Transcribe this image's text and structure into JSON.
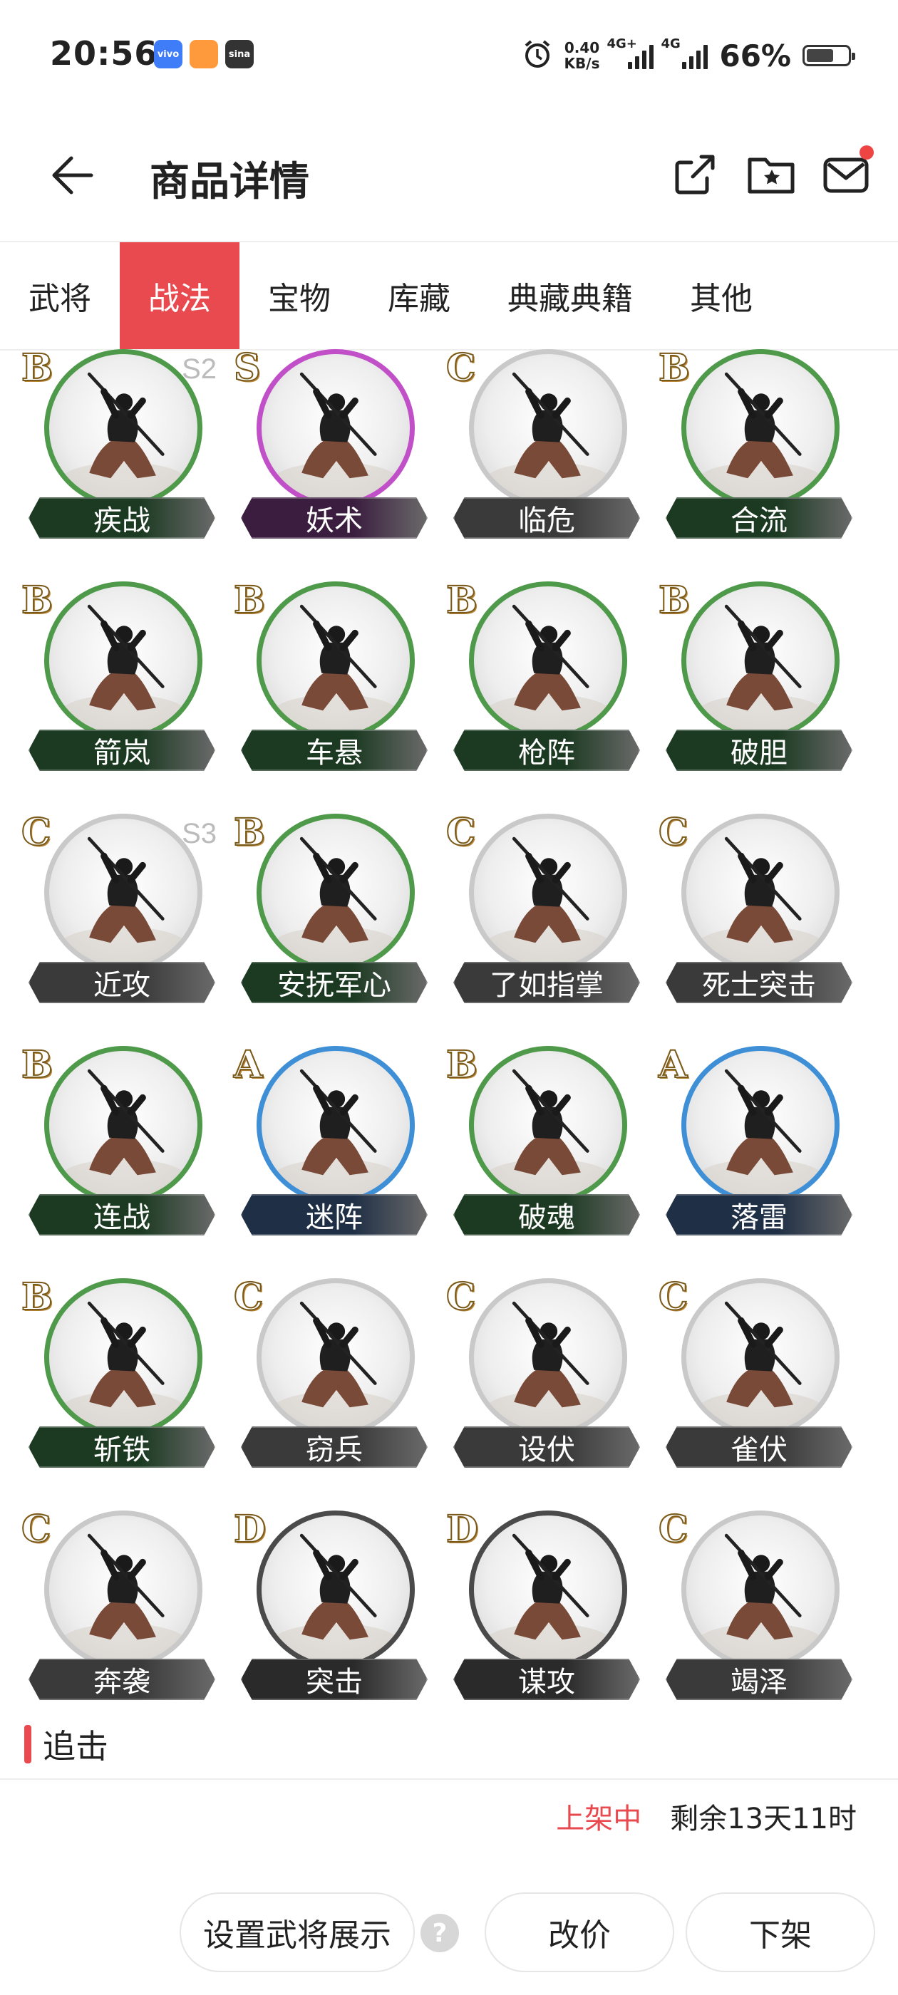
{
  "status_bar": {
    "time": "20:56",
    "net_speed_value": "0.40",
    "net_speed_unit": "KB/s",
    "sim1_label": "4G+",
    "sim2_label": "4G",
    "battery_percent": "66%",
    "battery_level": 0.66,
    "app_icons": [
      {
        "name": "vivo-icon",
        "label": "vivo",
        "color": "#3f7cf7"
      },
      {
        "name": "game-app-icon",
        "label": "",
        "color": "#ff9a3c"
      },
      {
        "name": "sina-icon",
        "label": "sina",
        "color": "#333333"
      }
    ]
  },
  "header": {
    "title": "商品详情",
    "icons": [
      "back-arrow-icon",
      "share-icon",
      "favorite-folder-icon",
      "mail-icon"
    ]
  },
  "tabs": [
    {
      "label": "武将",
      "active": false
    },
    {
      "label": "战法",
      "active": true
    },
    {
      "label": "宝物",
      "active": false
    },
    {
      "label": "库藏",
      "active": false
    },
    {
      "label": "典藏典籍",
      "active": false
    },
    {
      "label": "其他",
      "active": false
    }
  ],
  "skills": [
    {
      "name": "疾战",
      "rank": "B",
      "season": "S2"
    },
    {
      "name": "妖术",
      "rank": "S",
      "season": ""
    },
    {
      "name": "临危",
      "rank": "C",
      "season": ""
    },
    {
      "name": "合流",
      "rank": "B",
      "season": ""
    },
    {
      "name": "箭岚",
      "rank": "B",
      "season": ""
    },
    {
      "name": "车悬",
      "rank": "B",
      "season": ""
    },
    {
      "name": "枪阵",
      "rank": "B",
      "season": ""
    },
    {
      "name": "破胆",
      "rank": "B",
      "season": ""
    },
    {
      "name": "近攻",
      "rank": "C",
      "season": "S3"
    },
    {
      "name": "安抚军心",
      "rank": "B",
      "season": ""
    },
    {
      "name": "了如指掌",
      "rank": "C",
      "season": ""
    },
    {
      "name": "死士突击",
      "rank": "C",
      "season": ""
    },
    {
      "name": "连战",
      "rank": "B",
      "season": ""
    },
    {
      "name": "迷阵",
      "rank": "A",
      "season": ""
    },
    {
      "name": "破魂",
      "rank": "B",
      "season": ""
    },
    {
      "name": "落雷",
      "rank": "A",
      "season": ""
    },
    {
      "name": "斩铁",
      "rank": "B",
      "season": ""
    },
    {
      "name": "窃兵",
      "rank": "C",
      "season": ""
    },
    {
      "name": "设伏",
      "rank": "C",
      "season": ""
    },
    {
      "name": "雀伏",
      "rank": "C",
      "season": ""
    },
    {
      "name": "奔袭",
      "rank": "C",
      "season": ""
    },
    {
      "name": "突击",
      "rank": "D",
      "season": ""
    },
    {
      "name": "谋攻",
      "rank": "D",
      "season": ""
    },
    {
      "name": "竭泽",
      "rank": "C",
      "season": ""
    }
  ],
  "rank_colors": {
    "S": {
      "ring": "#c04fc8",
      "bar": "#3a1d3f"
    },
    "A": {
      "ring": "#3f8fd6",
      "bar": "#1f2f45"
    },
    "B": {
      "ring": "#4f9a4a",
      "bar": "#1c3a22"
    },
    "C": {
      "ring": "#c9c9c9",
      "bar": "#3a3a3a"
    },
    "D": {
      "ring": "#4a4a4a",
      "bar": "#2a2a2a"
    }
  },
  "section": {
    "title": "追击"
  },
  "listing": {
    "status": "上架中",
    "remaining": "剩余13天11时"
  },
  "actions": {
    "set_display_label": "设置武将展示",
    "change_price_label": "改价",
    "delist_label": "下架"
  }
}
